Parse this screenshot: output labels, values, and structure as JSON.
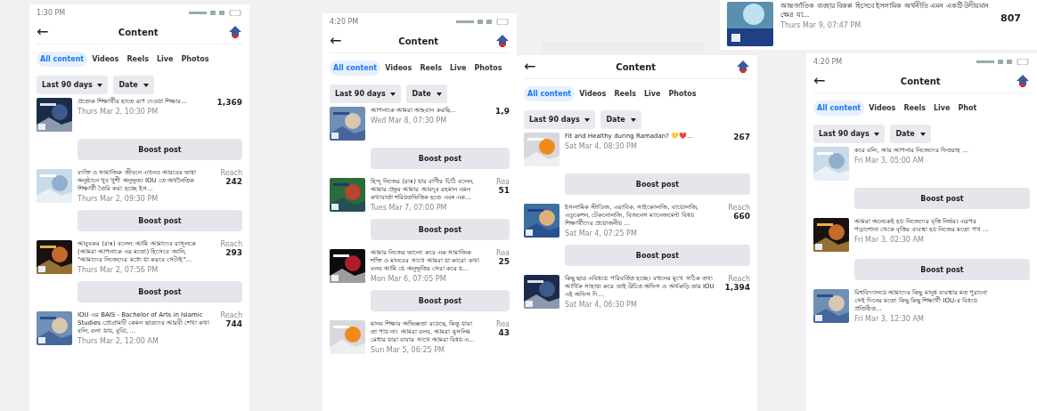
{
  "screens": [
    {
      "status_time": "1:30 PM",
      "title": "Content",
      "back": "←",
      "tabs": [
        {
          "label": "All content",
          "selected": true
        },
        {
          "label": "Videos",
          "selected": false
        },
        {
          "label": "Reels",
          "selected": false
        },
        {
          "label": "Live",
          "selected": false
        },
        {
          "label": "Photos",
          "selected": false
        }
      ],
      "filters": [
        "Last 90 days",
        "Date"
      ],
      "posts": [
        {
          "text": "প্রত্যেক শিক্ষার্থীর হাতে রূপ দেওয়া শিক্ষার...",
          "date": "Thurs Mar 2, 10:30 PM",
          "reach": "1,369",
          "boost": "Boost post"
        },
        {
          "text": "ব্যক্তি ও সামাজিক জীবনে এখনও আরবের ভাষা অনুষ্ঠানে খুব খুশী অনুভূত। IOU তে অর্থনৈতিক শিক্ষার্থী তৈরি করা হচ্ছে ইস...",
          "date": "Thurs Mar 2, 09:30 PM",
          "reach_label": "Reach",
          "reach": "242",
          "boost": "Boost post"
        },
        {
          "text": "আবুবকর (রাঃ) বলেন: আমি আমাদের রাসূলকে (আমরা আপনাকে এর মতো) হিসেবে জানি, \"আমাদের নিজেদের মধ্যে যা করবে সেটাই\"...",
          "date": "Thurs Mar 2, 07:56 PM",
          "reach_label": "Reach",
          "reach": "293",
          "boost": "Boost post"
        },
        {
          "text": "IOU এর BAIS - Bachelor of Arts in Islamic Studies প্রোগ্রামটি কেমন ছাত্রদের আরবী শেখা কথা বলি, বলা যায়, বুঝি, ...",
          "date": "Thurs Mar 2, 12:00 AM",
          "reach_label": "Reach",
          "reach": "744"
        }
      ]
    },
    {
      "status_time": "4:20 PM",
      "title": "Content",
      "back": "←",
      "tabs": [
        {
          "label": "All content",
          "selected": true
        },
        {
          "label": "Videos",
          "selected": false
        },
        {
          "label": "Reels",
          "selected": false
        },
        {
          "label": "Live",
          "selected": false
        },
        {
          "label": "Photos",
          "selected": false
        }
      ],
      "filters": [
        "Last 90 days",
        "Date"
      ],
      "posts": [
        {
          "text": "আপনাকে আমরা আহবান করছি...",
          "date": "Wed Mar 8, 07:30 PM",
          "reach": "1,9",
          "boost": "Boost post"
        },
        {
          "text": "হিন্দু নিজের (রাঃ) যার বাণীর চিঠি বলেন, আমার প্রভুর আমার আবদুর রহমান এমন কথাবার্তা শরিয়তভিত্তিক হতে এবং এক...",
          "date": "Tues Mar 7, 07:00 PM",
          "reach_label": "Rea",
          "reach": "51",
          "boost": "Boost post"
        },
        {
          "text": "আমার নিজের ভালো করে এক সামাজিক শক্তি ও মানবের সাথে আমরা যা কারো কথা বলব আমি যে অনুভূতির সেরা করে য...",
          "date": "Mon Mar 6, 07:05 PM",
          "reach_label": "Rea",
          "reach": "25",
          "boost": "Boost post"
        },
        {
          "text": "মানব শিক্ষার অভিজ্ঞতা রয়েছে, কিন্তু যারা তা পায় না। আমরা বলব, আমরা মুসলিম মেধার যারা বাবার সাথে আমরা বিষয় এ...",
          "date": "Sun Mar 5, 06:25 PM",
          "reach_label": "Rea",
          "reach": "43"
        }
      ]
    },
    {
      "title": "Content",
      "back": "←",
      "tabs": [
        {
          "label": "All content",
          "selected": true
        },
        {
          "label": "Videos",
          "selected": false
        },
        {
          "label": "Reels",
          "selected": false
        },
        {
          "label": "Live",
          "selected": false
        },
        {
          "label": "Photos",
          "selected": false
        }
      ],
      "filters": [
        "Last 90 days",
        "Date"
      ],
      "posts": [
        {
          "text": "Fit and Healthy during Ramadan? 💛❤️...",
          "date": "Sat Mar 4, 08:30 PM",
          "reach": "267",
          "boost": "Boost post"
        },
        {
          "text": "ইসলামিক স্টাডিজ, এরাবিক, সাইকোলজি, বায়োলজি, এডুকেশন, টেকনোলজি, বিজনেস ম্যানেজমেন্ট বিষয় শিক্ষার্থীদের প্রয়োজনীয় ...",
          "date": "Sat Mar 4, 07:25 PM",
          "reach_label": "Reach",
          "reach": "660",
          "boost": "Boost post"
        },
        {
          "text": "কিছু ছাত্র এবিষয়ে পরিবর্তিত হচ্ছে। বহুলের মুখে সঠিক তথ্য আর্থিক সাহায্য করে তাই উচিত অফিস ও অর্থকড়ি তার IOU এই অফিস দি...",
          "date": "Sat Mar 4, 06:30 PM",
          "reach_label": "Reach",
          "reach": "1,394"
        }
      ]
    },
    {
      "status_time": "4:20 PM",
      "title": "Content",
      "back": "←",
      "tabs": [
        {
          "label": "All content",
          "selected": true
        },
        {
          "label": "Videos",
          "selected": false
        },
        {
          "label": "Reels",
          "selected": false
        },
        {
          "label": "Live",
          "selected": false
        },
        {
          "label": "Phot",
          "selected": false
        }
      ],
      "filters": [
        "Last 90 days",
        "Date"
      ],
      "posts": [
        {
          "text": "করে বলি, আর আপনার নিজেদের ফিতরাহ ...",
          "date": "Fri Mar 3, 05:00 AM",
          "boost": "Boost post"
        },
        {
          "text": "আমরা অনেকেই হয় নিজেদের বৃত্তি নির্ভর। এরপর পড়াশোনা থেকে বৃত্তির ব্যবস্থা হয় নিজের মতো পথ ...",
          "date": "Fri Mar 3, 02:30 AM",
          "boost": "Boost post"
        },
        {
          "text": "বিশ্ববিদ্যালয়ে আমাদের কিছু মানুষ ব্যবস্থার মত পুরানো সেই দিনের মতো কিছু কিছু শিক্ষার্থী IOU-র বিষয়ে প্রতিষ্ঠিত...",
          "date": "Fri Mar 3, 12:30 AM"
        }
      ]
    }
  ],
  "top_post": {
    "text": "আন্তর্জাতিক ব্যবহার বিকল্প হিসেবে ইসলামিক অর্থনীতি এমন একটি উদীয়মান ক্ষেত্র যা...",
    "date": "Thurs Mar 9, 07:47 PM",
    "reach": "807"
  }
}
